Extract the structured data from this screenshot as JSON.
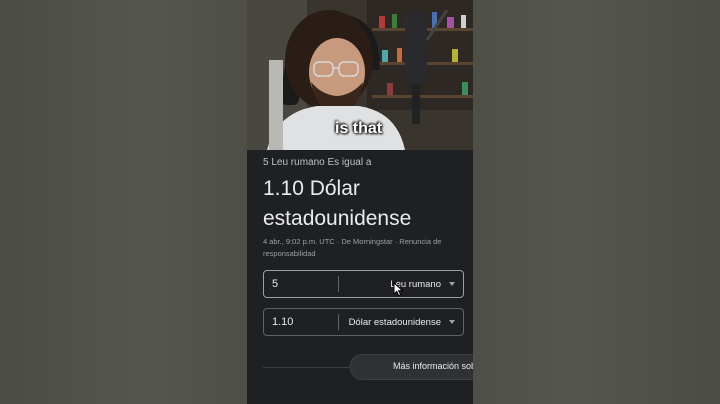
{
  "caption": "is that",
  "converter": {
    "source_line": "5 Leu rumano Es igual a",
    "result_line1": "1.10 Dólar",
    "result_line2": "estadounidense",
    "meta_line1": "4 abr., 9:02 p.m. UTC · De Morningstar · Renuncia de",
    "meta_line2": "responsabilidad",
    "from": {
      "amount": "5",
      "currency": "Leu rumano"
    },
    "to": {
      "amount": "1.10",
      "currency": "Dólar estadounidense"
    },
    "more_info": "Más información sob"
  },
  "colors": {
    "card_background": "#1f2023",
    "text_primary": "#e8eaed",
    "text_secondary": "#9aa0a6",
    "border": "#5f6368"
  },
  "icons": {
    "dropdown": "chevron-down-icon",
    "pointer": "mouse-cursor-icon"
  }
}
